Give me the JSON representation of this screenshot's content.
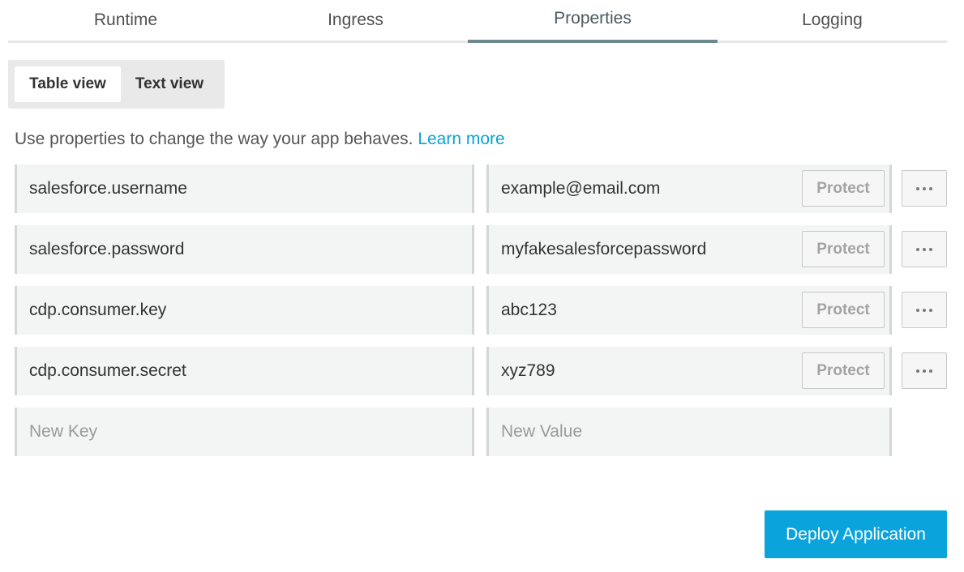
{
  "tabs": [
    {
      "label": "Runtime"
    },
    {
      "label": "Ingress"
    },
    {
      "label": "Properties"
    },
    {
      "label": "Logging"
    }
  ],
  "view_toggle": {
    "table_label": "Table view",
    "text_label": "Text view",
    "active": "Table view"
  },
  "description": {
    "text": "Use properties to change the way your app behaves.",
    "link": "Learn more"
  },
  "properties": [
    {
      "key": "salesforce.username",
      "value": "example@email.com",
      "protect_label": "Protect"
    },
    {
      "key": "salesforce.password",
      "value": "myfakesalesforcepassword",
      "protect_label": "Protect"
    },
    {
      "key": "cdp.consumer.key",
      "value": "abc123",
      "protect_label": "Protect"
    },
    {
      "key": "cdp.consumer.secret",
      "value": "xyz789",
      "protect_label": "Protect"
    }
  ],
  "new_row": {
    "key_placeholder": "New Key",
    "value_placeholder": "New Value"
  },
  "actions": {
    "more_icon": "ellipsis-icon",
    "deploy_label": "Deploy Application"
  },
  "colors": {
    "accent": "#0aa3dc",
    "link": "#0aa3d6",
    "active_tab_underline": "#6f8991"
  }
}
